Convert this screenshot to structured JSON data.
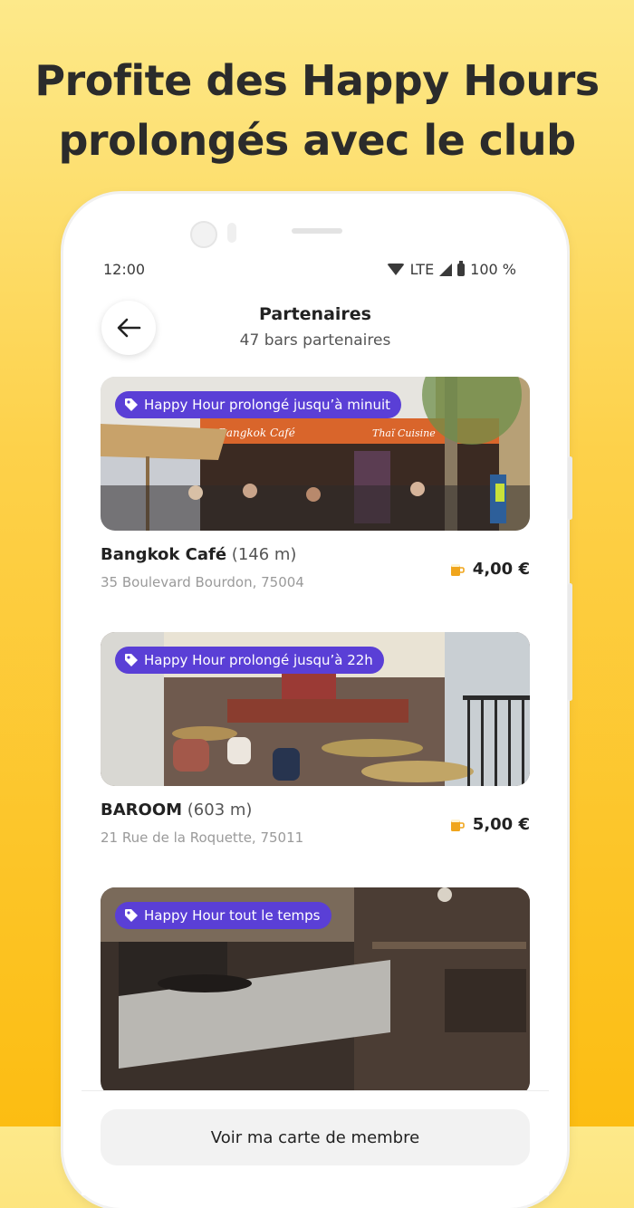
{
  "headline": {
    "line1": "Profite des Happy Hours",
    "line2": "prolongés avec le club"
  },
  "status": {
    "time": "12:00",
    "network": "LTE",
    "battery": "100 %"
  },
  "header": {
    "title": "Partenaires",
    "subtitle": "47 bars partenaires"
  },
  "bars": [
    {
      "tag": "Happy Hour prolongé jusqu’à minuit",
      "name": "Bangkok Café",
      "distance": "(146 m)",
      "address": "35 Boulevard Bourdon, 75004",
      "price": "4,00 €"
    },
    {
      "tag": "Happy Hour prolongé jusqu’à 22h",
      "name": "BAROOM",
      "distance": "(603 m)",
      "address": "21 Rue de la Roquette, 75011",
      "price": "5,00 €"
    },
    {
      "tag": "Happy Hour tout le temps"
    }
  ],
  "photo_signs": {
    "bangkok_sign": "Bangkok Café",
    "thai_sign": "Thaï Cuisine"
  },
  "footer": {
    "member_button": "Voir ma carte de membre"
  },
  "colors": {
    "accent": "#5a3fd6",
    "background_top": "#fde98a",
    "background_bottom": "#fcbd12"
  },
  "icons": {
    "back": "arrow-left-icon",
    "tag": "price-tag-icon",
    "beer": "beer-mug-icon"
  }
}
